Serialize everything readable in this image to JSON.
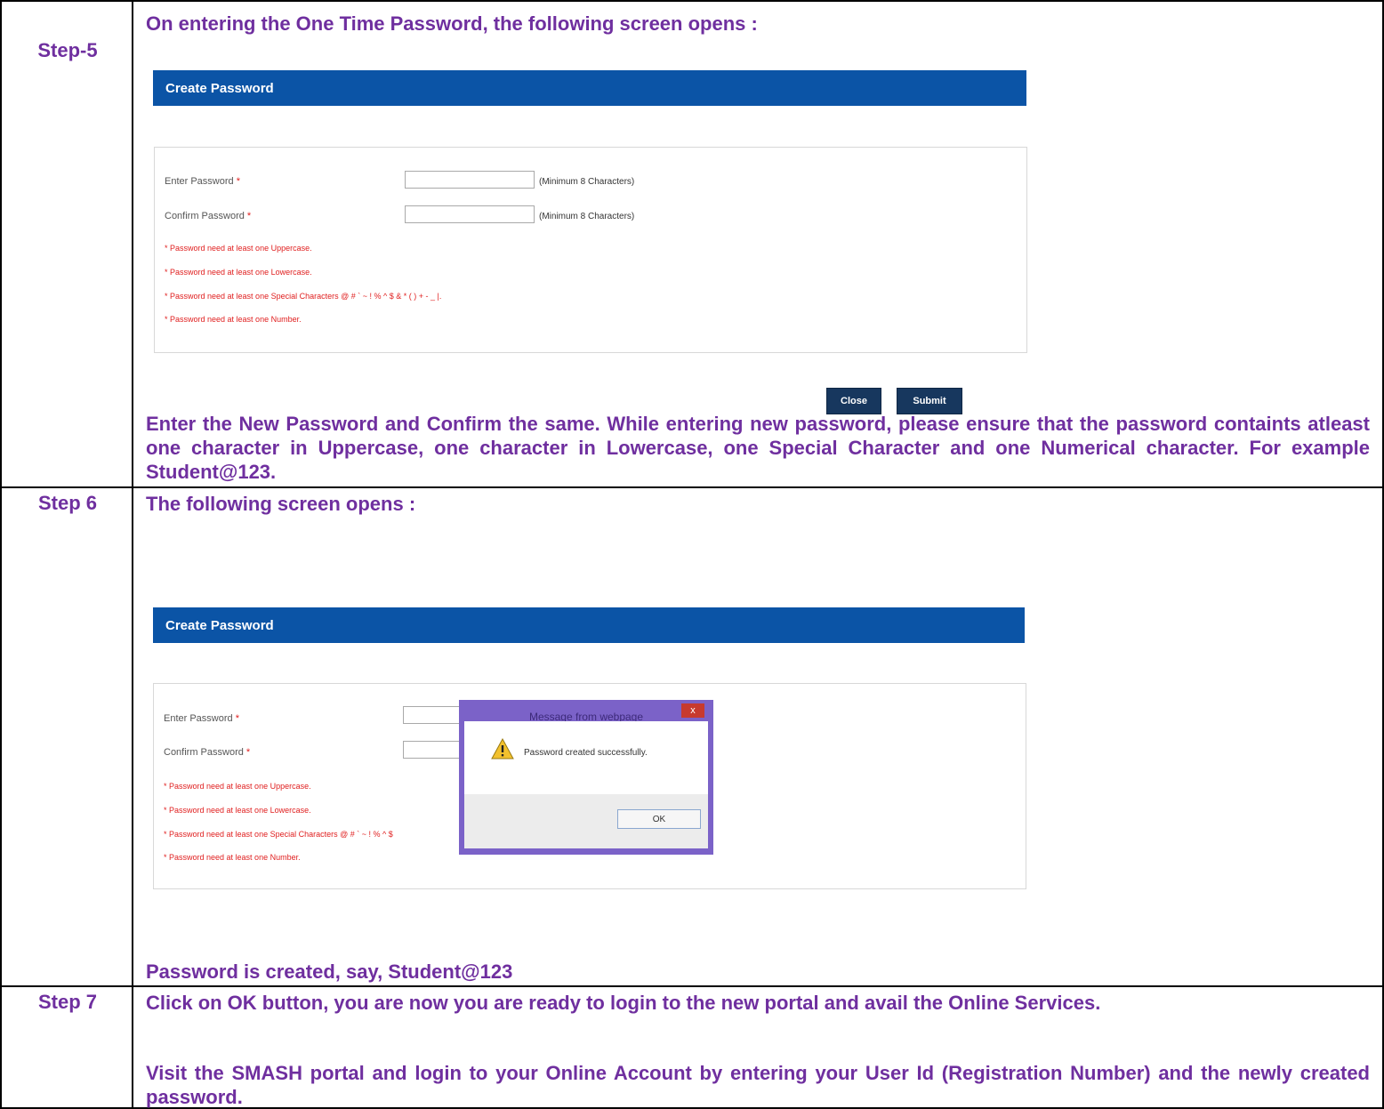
{
  "steps": {
    "step5": {
      "label": "Step-5",
      "intro": "On entering the One Time Password, the following screen opens :",
      "description": "Enter the New Password and Confirm the same. While entering new password, please ensure that the password containts atleast one character in Uppercase, one character in Lowercase, one Special Character and one Numerical character. For example  Student@123."
    },
    "step6": {
      "label": "Step 6",
      "intro": "The following screen opens :",
      "description": "Password is created, say, Student@123"
    },
    "step7": {
      "label": "Step 7",
      "paragraph1": "Click on OK button, you are now you are ready to login to the new portal and avail the Online Services.",
      "paragraph2": "Visit the SMASH portal  and login to your Online Account by entering  your User Id (Registration Number) and the newly created password."
    }
  },
  "form": {
    "header_title": "Create Password",
    "enter_password_label": "Enter Password",
    "confirm_password_label": "Confirm Password",
    "required_mark": "*",
    "min_hint": "(Minimum 8 Characters)",
    "rules": [
      "* Password need at least one Uppercase.",
      "* Password need at least one Lowercase.",
      "* Password need at least one Special Characters @ # ` ~ ! % ^ $ & * ( ) + - _ |.",
      "* Password need at least one Number."
    ],
    "rule3_truncated": "* Password need at least one Special Characters @ # ` ~ ! % ^ $",
    "close_button": "Close",
    "submit_button": "Submit"
  },
  "dialog": {
    "title": "Message from webpage",
    "close_glyph": "x",
    "message": "Password created successfully.",
    "ok_button": "OK",
    "warning_icon": "warning-triangle-icon"
  },
  "colors": {
    "step_text": "#6f2f9f",
    "header_blue": "#0b54a6",
    "rule_red": "#e02020",
    "dialog_frame": "#7b62c8"
  }
}
